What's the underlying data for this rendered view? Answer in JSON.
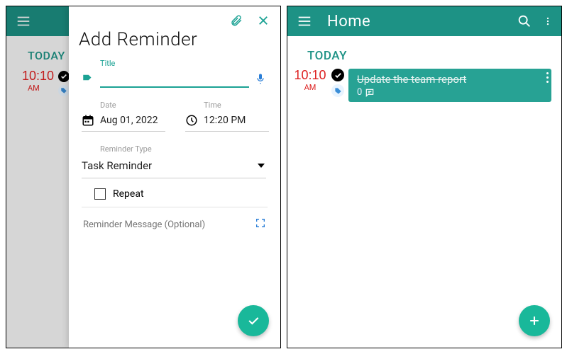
{
  "left": {
    "under": {
      "today_label": "TODAY",
      "time": "10:10",
      "ampm": "AM"
    },
    "sheet": {
      "title": "Add Reminder",
      "title_field_label": "Title",
      "title_value": "",
      "date_label": "Date",
      "date_value": "Aug 01, 2022",
      "time_label": "Time",
      "time_value": "12:20 PM",
      "type_label": "Reminder Type",
      "type_value": "Task Reminder",
      "repeat_label": "Repeat",
      "message_placeholder": "Reminder Message (Optional)"
    }
  },
  "right": {
    "appbar_title": "Home",
    "today_label": "TODAY",
    "item": {
      "time": "10:10",
      "ampm": "AM",
      "title": "Update the team report",
      "comment_count": "0"
    }
  }
}
